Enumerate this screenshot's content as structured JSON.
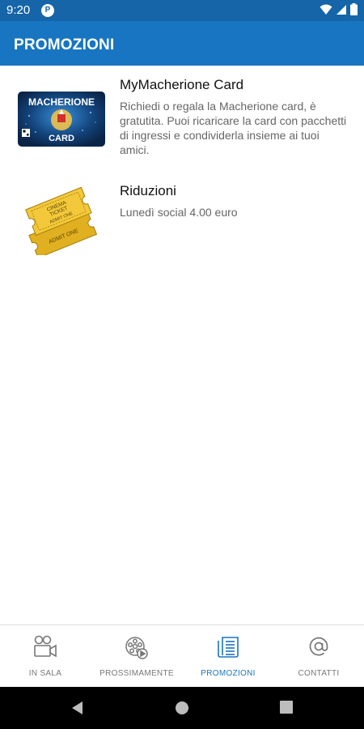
{
  "status_bar": {
    "time": "9:20",
    "app_icon": "P"
  },
  "header": {
    "title": "PROMOZIONI"
  },
  "promotions": [
    {
      "title": "MyMacherione Card",
      "description": "Richiedi o regala la Macherione card, è gratutita. Puoi ricaricare la card con pacchetti di ingressi e condividerla insieme ai tuoi amici.",
      "image": {
        "brand_top": "MACHERIONE",
        "brand_bottom": "CARD"
      }
    },
    {
      "title": "Riduzioni",
      "description": "Lunedì social 4.00 euro",
      "image": {
        "ticket_line1": "CINEMA",
        "ticket_line2": "TICKET",
        "ticket_line3": "ADMIT ONE",
        "ticket_back": "ADMIT ONE"
      }
    }
  ],
  "bottom_nav": [
    {
      "label": "IN SALA",
      "icon": "film-camera-icon",
      "active": false
    },
    {
      "label": "PROSSIMAMENTE",
      "icon": "film-reel-play-icon",
      "active": false
    },
    {
      "label": "PROMOZIONI",
      "icon": "newspaper-icon",
      "active": true
    },
    {
      "label": "CONTATTI",
      "icon": "at-sign-icon",
      "active": false
    }
  ],
  "colors": {
    "status_bar": "#1565a8",
    "app_bar": "#1875c1",
    "active_nav": "#1875c1",
    "inactive_nav": "#777777"
  }
}
